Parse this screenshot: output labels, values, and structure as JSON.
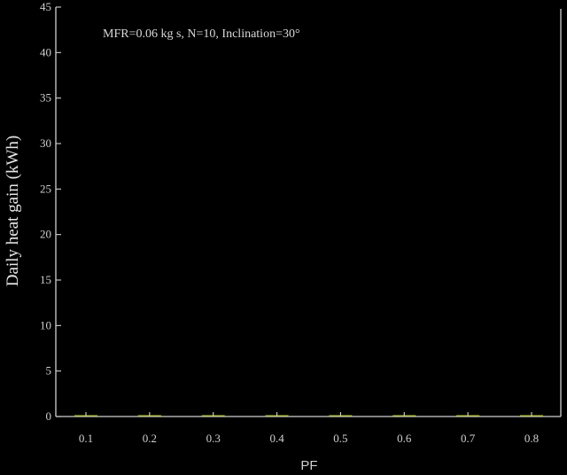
{
  "chart_data": {
    "type": "bar",
    "title": "",
    "annotation": "MFR=0.06 kg s, N=10, Inclination=30°",
    "xlabel": "PF",
    "ylabel": "Daily heat gain (kWh)",
    "categories": [
      "0.1",
      "0.2",
      "0.3",
      "0.4",
      "0.5",
      "0.6",
      "0.7",
      "0.8"
    ],
    "values": [
      0.1,
      0.1,
      0.1,
      0.1,
      0.1,
      0.1,
      0.1,
      0.1
    ],
    "ylim": [
      0,
      45
    ],
    "yticks": [
      0,
      5,
      10,
      15,
      20,
      25,
      30,
      35,
      40,
      45
    ],
    "grid": false,
    "colors": {
      "background": "#000000",
      "axis": "#d0d0d0",
      "bar": "#b9c24a"
    }
  }
}
